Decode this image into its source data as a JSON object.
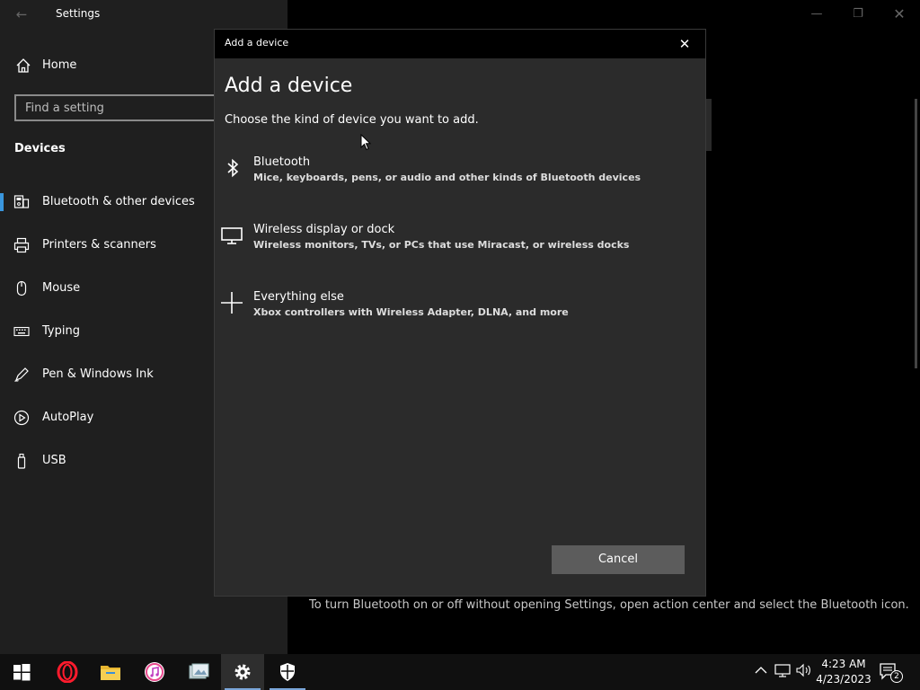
{
  "settings_window": {
    "title": "Settings",
    "home_label": "Home",
    "search_placeholder": "Find a setting",
    "section_title": "Devices",
    "nav_items": [
      {
        "label": "Bluetooth & other devices",
        "icon": "bluetooth-devices-icon",
        "selected": true
      },
      {
        "label": "Printers & scanners",
        "icon": "printer-icon",
        "selected": false
      },
      {
        "label": "Mouse",
        "icon": "mouse-icon",
        "selected": false
      },
      {
        "label": "Typing",
        "icon": "keyboard-icon",
        "selected": false
      },
      {
        "label": "Pen & Windows Ink",
        "icon": "pen-icon",
        "selected": false
      },
      {
        "label": "AutoPlay",
        "icon": "autoplay-icon",
        "selected": false
      },
      {
        "label": "USB",
        "icon": "usb-icon",
        "selected": false
      }
    ],
    "hint_text": "To turn Bluetooth on or off without opening Settings, open action center and select the Bluetooth icon."
  },
  "dialog": {
    "titlebar": "Add a device",
    "heading": "Add a device",
    "subtitle": "Choose the kind of device you want to add.",
    "options": [
      {
        "title": "Bluetooth",
        "description": "Mice, keyboards, pens, or audio and other kinds of Bluetooth devices",
        "icon": "bluetooth-icon"
      },
      {
        "title": "Wireless display or dock",
        "description": "Wireless monitors, TVs, or PCs that use Miracast, or wireless docks",
        "icon": "monitor-icon"
      },
      {
        "title": "Everything else",
        "description": "Xbox controllers with Wireless Adapter, DLNA, and more",
        "icon": "plus-icon"
      }
    ],
    "cancel_label": "Cancel"
  },
  "taskbar": {
    "apps": [
      "windows-start-icon",
      "opera-icon",
      "file-explorer-icon",
      "itunes-icon",
      "photos-icon",
      "settings-gear-icon",
      "windows-security-icon"
    ],
    "active_app": "settings-gear-icon",
    "time": "4:23 AM",
    "date": "4/23/2023",
    "notification_count": "2"
  },
  "colors": {
    "accent": "#3a96dd",
    "pane_bg": "#1f1f1f",
    "dialog_bg": "#2b2b2b",
    "button_bg": "#5c5c5c"
  }
}
